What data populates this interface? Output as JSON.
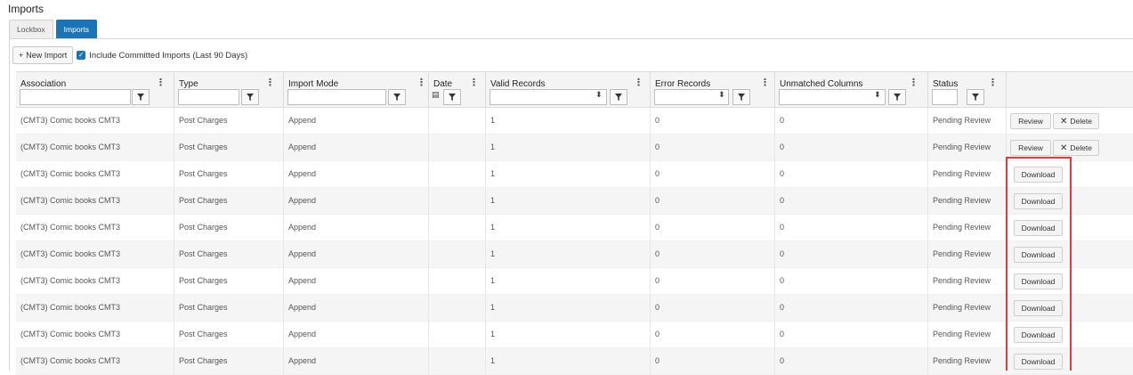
{
  "page": {
    "title": "Imports"
  },
  "tabs": [
    {
      "label": "Lockbox",
      "active": false
    },
    {
      "label": "Imports",
      "active": true
    }
  ],
  "toolbar": {
    "new_import_label": "New Import",
    "plus_icon": "+",
    "include_committed_label": "Include Committed Imports (Last 90 Days)",
    "include_committed_checked": true
  },
  "columns": [
    {
      "title": "Association"
    },
    {
      "title": "Type"
    },
    {
      "title": "Import Mode"
    },
    {
      "title": "Date"
    },
    {
      "title": "Valid Records"
    },
    {
      "title": "Error Records"
    },
    {
      "title": "Unmatched Columns"
    },
    {
      "title": "Status"
    }
  ],
  "actions": {
    "review_label": "Review",
    "delete_label": "Delete",
    "download_label": "Download"
  },
  "rows": [
    {
      "association": "(CMT3) Comic books CMT3",
      "type": "Post Charges",
      "mode": "Append",
      "date": "",
      "valid": "1",
      "errors": "0",
      "unmatched": "0",
      "status": "Pending Review",
      "actions": "review-delete"
    },
    {
      "association": "(CMT3) Comic books CMT3",
      "type": "Post Charges",
      "mode": "Append",
      "date": "",
      "valid": "1",
      "errors": "0",
      "unmatched": "0",
      "status": "Pending Review",
      "actions": "review-delete"
    },
    {
      "association": "(CMT3) Comic books CMT3",
      "type": "Post Charges",
      "mode": "Append",
      "date": "",
      "valid": "1",
      "errors": "0",
      "unmatched": "0",
      "status": "Pending Review",
      "actions": "download"
    },
    {
      "association": "(CMT3) Comic books CMT3",
      "type": "Post Charges",
      "mode": "Append",
      "date": "",
      "valid": "1",
      "errors": "0",
      "unmatched": "0",
      "status": "Pending Review",
      "actions": "download"
    },
    {
      "association": "(CMT3) Comic books CMT3",
      "type": "Post Charges",
      "mode": "Append",
      "date": "",
      "valid": "1",
      "errors": "0",
      "unmatched": "0",
      "status": "Pending Review",
      "actions": "download"
    },
    {
      "association": "(CMT3) Comic books CMT3",
      "type": "Post Charges",
      "mode": "Append",
      "date": "",
      "valid": "1",
      "errors": "0",
      "unmatched": "0",
      "status": "Pending Review",
      "actions": "download"
    },
    {
      "association": "(CMT3) Comic books CMT3",
      "type": "Post Charges",
      "mode": "Append",
      "date": "",
      "valid": "1",
      "errors": "0",
      "unmatched": "0",
      "status": "Pending Review",
      "actions": "download"
    },
    {
      "association": "(CMT3) Comic books CMT3",
      "type": "Post Charges",
      "mode": "Append",
      "date": "",
      "valid": "1",
      "errors": "0",
      "unmatched": "0",
      "status": "Pending Review",
      "actions": "download"
    },
    {
      "association": "(CMT3) Comic books CMT3",
      "type": "Post Charges",
      "mode": "Append",
      "date": "",
      "valid": "1",
      "errors": "0",
      "unmatched": "0",
      "status": "Pending Review",
      "actions": "download"
    },
    {
      "association": "(CMT3) Comic books CMT3",
      "type": "Post Charges",
      "mode": "Append",
      "date": "",
      "valid": "1",
      "errors": "0",
      "unmatched": "0",
      "status": "Pending Review",
      "actions": "download"
    }
  ],
  "colors": {
    "accent": "#1a74b8",
    "highlight_border": "#e23b3b",
    "row_alt": "#f5f5f5"
  },
  "icons": {
    "column_menu": "vertical-ellipsis-icon",
    "filter": "funnel-filter-icon",
    "spinner": "up-down-spinner-icon",
    "delete": "close-x-icon",
    "checkbox": "checkmark-icon"
  }
}
